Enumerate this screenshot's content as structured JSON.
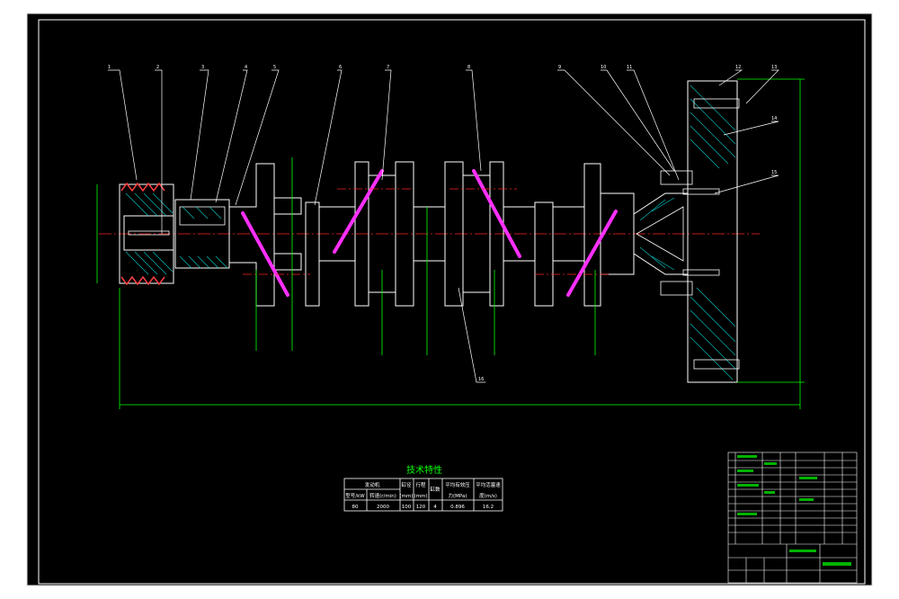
{
  "title": "技术特性",
  "spec_table": {
    "header_row1": [
      "发动机",
      "缸径",
      "行程",
      "缸数",
      "平均有效压",
      "平均活塞速"
    ],
    "header_row2": [
      "型号/kW",
      "转速(r/min)",
      "(mm)",
      "(mm)",
      "",
      "力(MPa)",
      "度(m/s)"
    ],
    "values": [
      "80",
      "2000",
      "100",
      "120",
      "4",
      "0.896",
      "16.2"
    ]
  },
  "leaders": [
    "1",
    "2",
    "3",
    "4",
    "5",
    "6",
    "7",
    "8",
    "9",
    "10",
    "11",
    "12",
    "13",
    "14",
    "15",
    "16"
  ],
  "colors": {
    "frame": "#ffffff",
    "part": "#ffffff",
    "dimension": "#00ff00",
    "centerline": "#ff0000",
    "section": "#ff00ff",
    "hatch": "#00ffff",
    "title": "#00ff00"
  }
}
